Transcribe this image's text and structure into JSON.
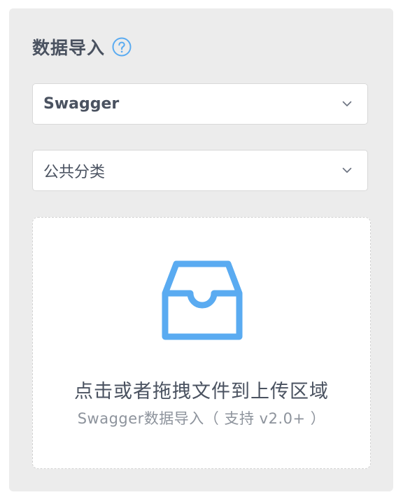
{
  "import_panel": {
    "title": "数据导入",
    "help_icon": "question-circle-icon",
    "type_select": {
      "selected": "Swagger"
    },
    "category_select": {
      "selected": "公共分类"
    },
    "upload": {
      "icon": "inbox-icon",
      "main_text": "点击或者拖拽文件到上传区域",
      "hint_text": "Swagger数据导入（ 支持 v2.0+ ）"
    }
  },
  "colors": {
    "accent": "#5aabf1",
    "panel_bg": "#ececec",
    "text": "#4a5260",
    "hint_text": "#8d939c"
  }
}
